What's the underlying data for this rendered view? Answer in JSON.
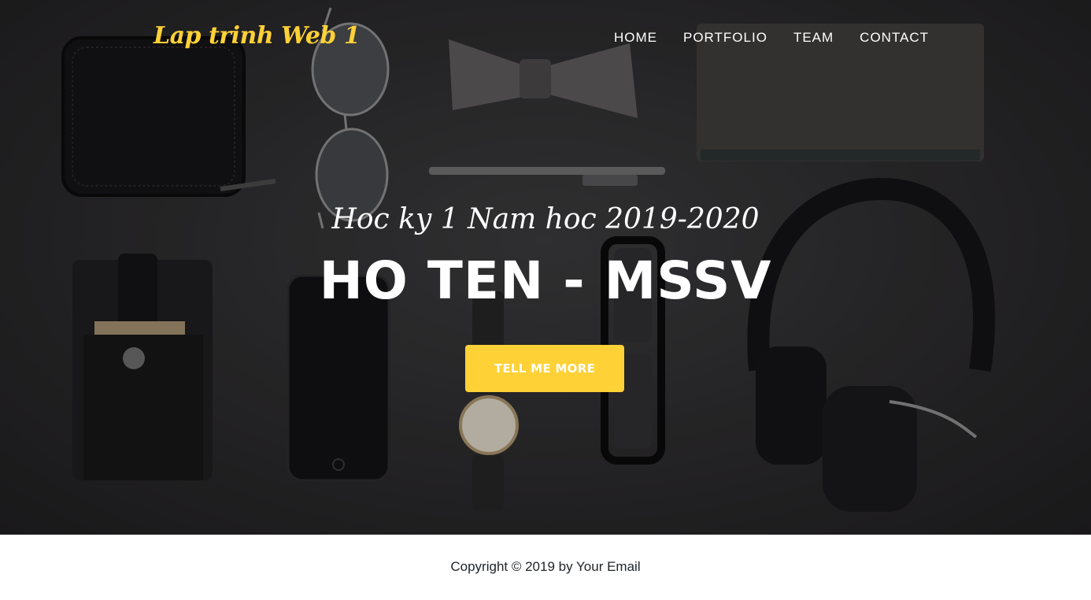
{
  "navbar": {
    "brand": "Lap trinh Web 1",
    "links": [
      "HOME",
      "PORTFOLIO",
      "TEAM",
      "CONTACT"
    ]
  },
  "hero": {
    "subheading": "Hoc ky 1 Nam hoc 2019-2020",
    "heading": "HO TEN - MSSV",
    "cta_label": "TELL ME MORE",
    "background_description_icons": [
      "wallet-icon",
      "sunglasses-icon",
      "bow-tie-icon",
      "notebook-icon",
      "pen-icon",
      "phone-icon",
      "card-holder-icon",
      "watch-icon",
      "eyeglasses-icon",
      "headphones-icon"
    ]
  },
  "footer": {
    "copyright": "Copyright © 2019 by Your Email"
  },
  "colors": {
    "accent": "#fed136",
    "hero_bg": "#2b2a2c",
    "text_light": "#ffffff",
    "footer_text": "#212529"
  }
}
